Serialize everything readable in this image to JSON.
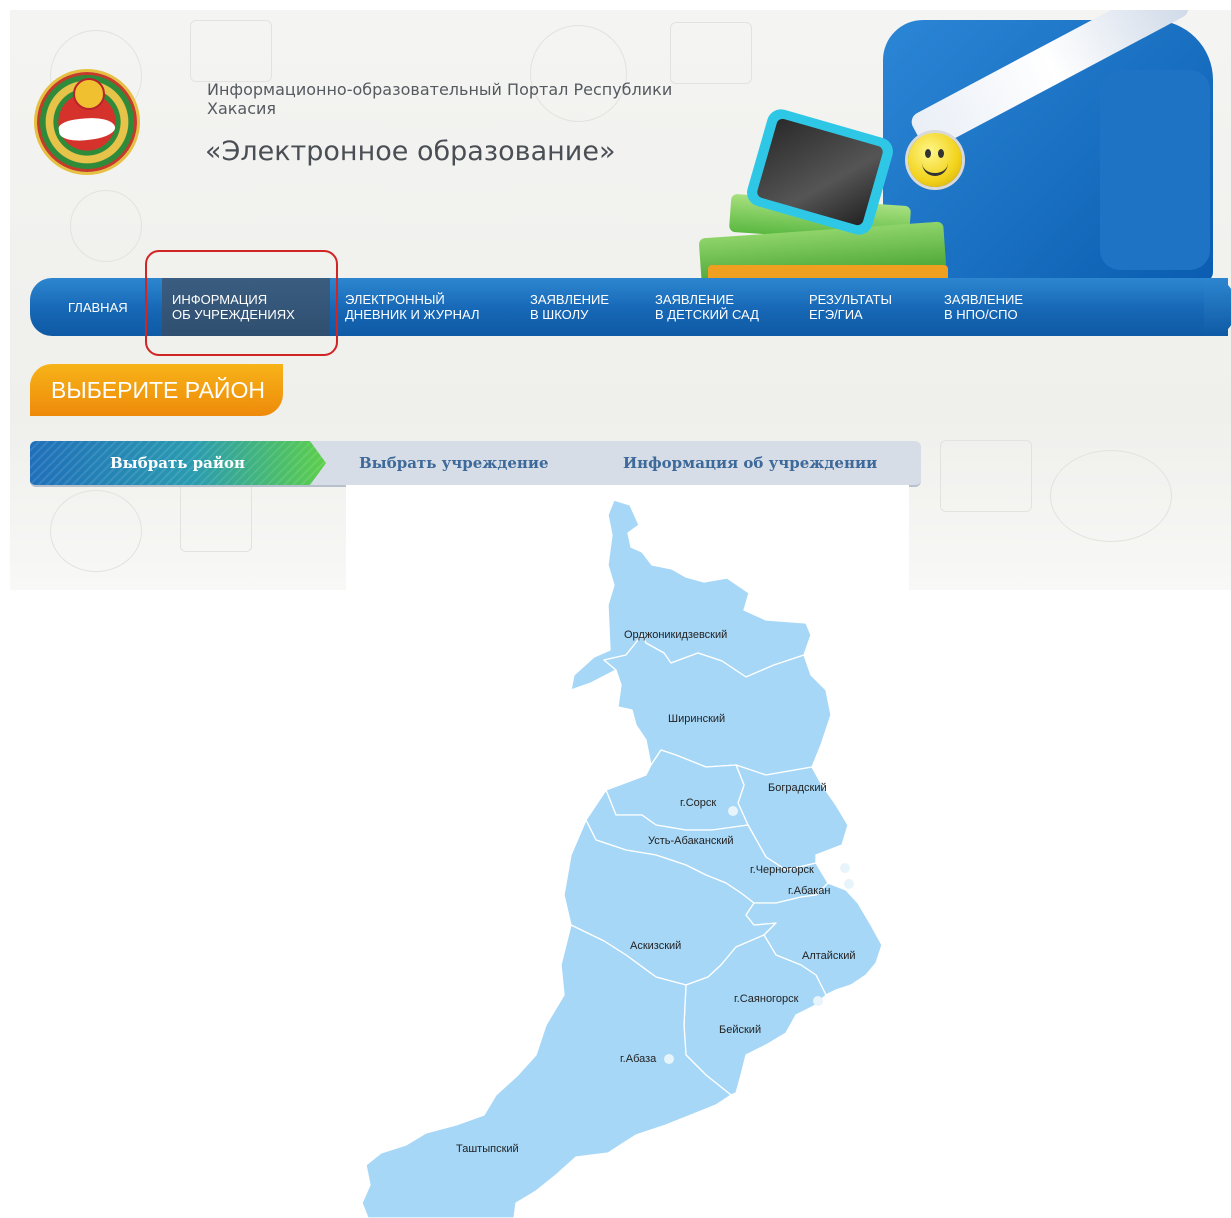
{
  "header": {
    "subtitle": "Информационно-образовательный Портал Республики Хакасия",
    "title": "«Электронное образование»"
  },
  "nav": {
    "items": [
      {
        "line1": "ГЛАВНАЯ",
        "line2": ""
      },
      {
        "line1": "ИНФОРМАЦИЯ",
        "line2": "ОБ УЧРЕЖДЕНИЯХ"
      },
      {
        "line1": "ЭЛЕКТРОННЫЙ",
        "line2": "ДНЕВНИК И ЖУРНАЛ"
      },
      {
        "line1": "ЗАЯВЛЕНИЕ",
        "line2": "В ШКОЛУ"
      },
      {
        "line1": "ЗАЯВЛЕНИЕ",
        "line2": "В ДЕТСКИЙ САД"
      },
      {
        "line1": "РЕЗУЛЬТАТЫ",
        "line2": "ЕГЭ/ГИА"
      },
      {
        "line1": "ЗАЯВЛЕНИЕ",
        "line2": "В НПО/СПО"
      }
    ],
    "active_index": 1
  },
  "section": {
    "label": "ВЫБЕРИТЕ РАЙОН"
  },
  "steps": {
    "items": [
      "Выбрать район",
      "Выбрать учреждение",
      "Информация об учреждении"
    ],
    "active_index": 0
  },
  "map": {
    "fill_color": "#a6d7f7",
    "border_color": "#ffffff",
    "districts": [
      "Орджоникидзевский",
      "Ширинский",
      "Боградский",
      "г.Сорск",
      "Усть-Абаканский",
      "г.Черногорск",
      "г.Абакан",
      "Аскизский",
      "Алтайский",
      "г.Саяногорск",
      "Бейский",
      "г.Абаза",
      "Таштыпский"
    ]
  }
}
